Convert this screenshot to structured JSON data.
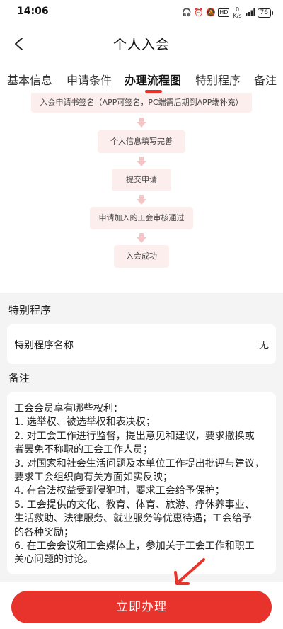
{
  "status_bar": {
    "time": "14:06",
    "net_speed": "0\nK/s",
    "hd": "HD",
    "battery": "76"
  },
  "header": {
    "title": "个人入会"
  },
  "tabs": [
    {
      "label": "基本信息"
    },
    {
      "label": "申请条件"
    },
    {
      "label": "办理流程图"
    },
    {
      "label": "特别程序"
    },
    {
      "label": "备注"
    }
  ],
  "flow": {
    "steps": [
      "入会申请书签名（APP可签名，PC端需后期到APP端补充）",
      "个人信息填写完善",
      "提交申请",
      "申请加入的工会审核通过",
      "入会成功"
    ]
  },
  "special": {
    "section_title": "特别程序",
    "label": "特别程序名称",
    "value": "无"
  },
  "notes": {
    "section_title": "备注",
    "lines": [
      "工会会员享有哪些权利：",
      "1. 选举权、被选举权和表决权；",
      "2. 对工会工作进行监督，提出意见和建议，要求撤换或",
      "者罢免不称职的工会工作人员；",
      "3. 对国家和社会生活问题及本单位工作提出批评与建议，",
      "要求工会组织向有关方面如实反映；",
      "4. 在合法权益受到侵犯时，要求工会给予保护；",
      "5. 工会提供的文化、教育、体育、旅游、疗休养事业、",
      "生活救助、法律服务、就业服务等优惠待遇；工会给予",
      "的各种奖励；",
      "6. 在工会会议和工会媒体上，参加关于工会工作和职工",
      "关心问题的讨论。"
    ]
  },
  "action": {
    "label": "立即办理"
  }
}
